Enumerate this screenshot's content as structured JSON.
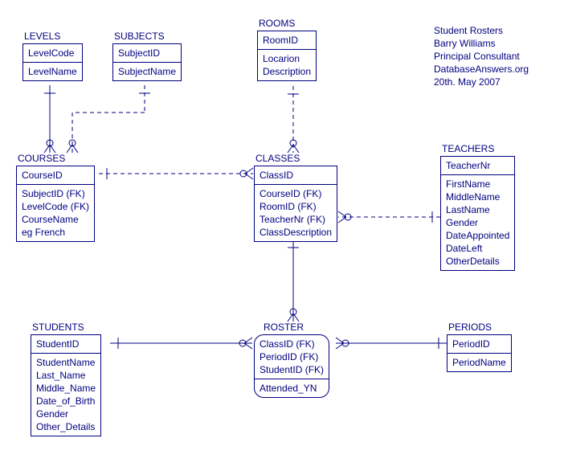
{
  "info": {
    "l1": "Student Rosters",
    "l2": "Barry Williams",
    "l3": "Principal Consultant",
    "l4": "DatabaseAnswers.org",
    "l5": "20th. May 2007"
  },
  "levels": {
    "title": "LEVELS",
    "pk": "LevelCode",
    "a1": "LevelName"
  },
  "subjects": {
    "title": "SUBJECTS",
    "pk": "SubjectID",
    "a1": "SubjectName"
  },
  "rooms": {
    "title": "ROOMS",
    "pk": "RoomID",
    "a1": "Locarion",
    "a2": "Description"
  },
  "courses": {
    "title": "COURSES",
    "pk": "CourseID",
    "a1": "SubjectID (FK)",
    "a2": "LevelCode (FK)",
    "a3": "CourseName",
    "a4": "eg French"
  },
  "classes": {
    "title": "CLASSES",
    "pk": "ClassID",
    "a1": "CourseID (FK)",
    "a2": "RoomID (FK)",
    "a3": "TeacherNr (FK)",
    "a4": "ClassDescription"
  },
  "teachers": {
    "title": "TEACHERS",
    "pk": "TeacherNr",
    "a1": "FirstName",
    "a2": "MiddleName",
    "a3": "LastName",
    "a4": "Gender",
    "a5": "DateAppointed",
    "a6": "DateLeft",
    "a7": "OtherDetails"
  },
  "students": {
    "title": "STUDENTS",
    "pk": "StudentID",
    "a1": "StudentName",
    "a2": "Last_Name",
    "a3": "Middle_Name",
    "a4": "Date_of_Birth",
    "a5": "Gender",
    "a6": "Other_Details"
  },
  "roster": {
    "title": "ROSTER",
    "pk1": "ClassID (FK)",
    "pk2": "PeriodID (FK)",
    "pk3": "StudentID (FK)",
    "a1": "Attended_YN"
  },
  "periods": {
    "title": "PERIODS",
    "pk": "PeriodID",
    "a1": "PeriodName"
  }
}
